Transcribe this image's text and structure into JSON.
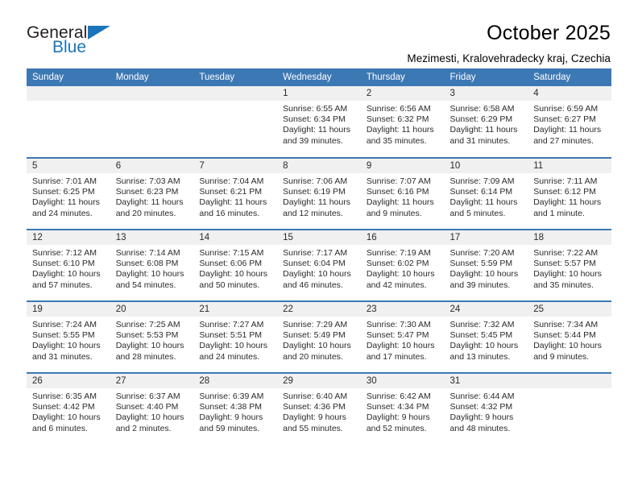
{
  "brand": {
    "name_top": "General",
    "name_bottom": "Blue",
    "triangle_color": "#1b75bb",
    "text_color": "#231f20"
  },
  "header": {
    "title": "October 2025",
    "subtitle": "Mezimesti, Kralovehradecky kraj, Czechia"
  },
  "theme": {
    "header_row_bg": "#3c78b4",
    "header_row_text": "#ffffff",
    "daynum_bg": "#f0f0f0",
    "cell_bg": "#ffffff",
    "grid_line": "#3c78b4"
  },
  "weekday_headers": [
    "Sunday",
    "Monday",
    "Tuesday",
    "Wednesday",
    "Thursday",
    "Friday",
    "Saturday"
  ],
  "weeks": [
    [
      {
        "day": "",
        "empty": true
      },
      {
        "day": "",
        "empty": true
      },
      {
        "day": "",
        "empty": true
      },
      {
        "day": "1",
        "sunrise": "Sunrise: 6:55 AM",
        "sunset": "Sunset: 6:34 PM",
        "daylight1": "Daylight: 11 hours",
        "daylight2": "and 39 minutes."
      },
      {
        "day": "2",
        "sunrise": "Sunrise: 6:56 AM",
        "sunset": "Sunset: 6:32 PM",
        "daylight1": "Daylight: 11 hours",
        "daylight2": "and 35 minutes."
      },
      {
        "day": "3",
        "sunrise": "Sunrise: 6:58 AM",
        "sunset": "Sunset: 6:29 PM",
        "daylight1": "Daylight: 11 hours",
        "daylight2": "and 31 minutes."
      },
      {
        "day": "4",
        "sunrise": "Sunrise: 6:59 AM",
        "sunset": "Sunset: 6:27 PM",
        "daylight1": "Daylight: 11 hours",
        "daylight2": "and 27 minutes."
      }
    ],
    [
      {
        "day": "5",
        "sunrise": "Sunrise: 7:01 AM",
        "sunset": "Sunset: 6:25 PM",
        "daylight1": "Daylight: 11 hours",
        "daylight2": "and 24 minutes."
      },
      {
        "day": "6",
        "sunrise": "Sunrise: 7:03 AM",
        "sunset": "Sunset: 6:23 PM",
        "daylight1": "Daylight: 11 hours",
        "daylight2": "and 20 minutes."
      },
      {
        "day": "7",
        "sunrise": "Sunrise: 7:04 AM",
        "sunset": "Sunset: 6:21 PM",
        "daylight1": "Daylight: 11 hours",
        "daylight2": "and 16 minutes."
      },
      {
        "day": "8",
        "sunrise": "Sunrise: 7:06 AM",
        "sunset": "Sunset: 6:19 PM",
        "daylight1": "Daylight: 11 hours",
        "daylight2": "and 12 minutes."
      },
      {
        "day": "9",
        "sunrise": "Sunrise: 7:07 AM",
        "sunset": "Sunset: 6:16 PM",
        "daylight1": "Daylight: 11 hours",
        "daylight2": "and 9 minutes."
      },
      {
        "day": "10",
        "sunrise": "Sunrise: 7:09 AM",
        "sunset": "Sunset: 6:14 PM",
        "daylight1": "Daylight: 11 hours",
        "daylight2": "and 5 minutes."
      },
      {
        "day": "11",
        "sunrise": "Sunrise: 7:11 AM",
        "sunset": "Sunset: 6:12 PM",
        "daylight1": "Daylight: 11 hours",
        "daylight2": "and 1 minute."
      }
    ],
    [
      {
        "day": "12",
        "sunrise": "Sunrise: 7:12 AM",
        "sunset": "Sunset: 6:10 PM",
        "daylight1": "Daylight: 10 hours",
        "daylight2": "and 57 minutes."
      },
      {
        "day": "13",
        "sunrise": "Sunrise: 7:14 AM",
        "sunset": "Sunset: 6:08 PM",
        "daylight1": "Daylight: 10 hours",
        "daylight2": "and 54 minutes."
      },
      {
        "day": "14",
        "sunrise": "Sunrise: 7:15 AM",
        "sunset": "Sunset: 6:06 PM",
        "daylight1": "Daylight: 10 hours",
        "daylight2": "and 50 minutes."
      },
      {
        "day": "15",
        "sunrise": "Sunrise: 7:17 AM",
        "sunset": "Sunset: 6:04 PM",
        "daylight1": "Daylight: 10 hours",
        "daylight2": "and 46 minutes."
      },
      {
        "day": "16",
        "sunrise": "Sunrise: 7:19 AM",
        "sunset": "Sunset: 6:02 PM",
        "daylight1": "Daylight: 10 hours",
        "daylight2": "and 42 minutes."
      },
      {
        "day": "17",
        "sunrise": "Sunrise: 7:20 AM",
        "sunset": "Sunset: 5:59 PM",
        "daylight1": "Daylight: 10 hours",
        "daylight2": "and 39 minutes."
      },
      {
        "day": "18",
        "sunrise": "Sunrise: 7:22 AM",
        "sunset": "Sunset: 5:57 PM",
        "daylight1": "Daylight: 10 hours",
        "daylight2": "and 35 minutes."
      }
    ],
    [
      {
        "day": "19",
        "sunrise": "Sunrise: 7:24 AM",
        "sunset": "Sunset: 5:55 PM",
        "daylight1": "Daylight: 10 hours",
        "daylight2": "and 31 minutes."
      },
      {
        "day": "20",
        "sunrise": "Sunrise: 7:25 AM",
        "sunset": "Sunset: 5:53 PM",
        "daylight1": "Daylight: 10 hours",
        "daylight2": "and 28 minutes."
      },
      {
        "day": "21",
        "sunrise": "Sunrise: 7:27 AM",
        "sunset": "Sunset: 5:51 PM",
        "daylight1": "Daylight: 10 hours",
        "daylight2": "and 24 minutes."
      },
      {
        "day": "22",
        "sunrise": "Sunrise: 7:29 AM",
        "sunset": "Sunset: 5:49 PM",
        "daylight1": "Daylight: 10 hours",
        "daylight2": "and 20 minutes."
      },
      {
        "day": "23",
        "sunrise": "Sunrise: 7:30 AM",
        "sunset": "Sunset: 5:47 PM",
        "daylight1": "Daylight: 10 hours",
        "daylight2": "and 17 minutes."
      },
      {
        "day": "24",
        "sunrise": "Sunrise: 7:32 AM",
        "sunset": "Sunset: 5:45 PM",
        "daylight1": "Daylight: 10 hours",
        "daylight2": "and 13 minutes."
      },
      {
        "day": "25",
        "sunrise": "Sunrise: 7:34 AM",
        "sunset": "Sunset: 5:44 PM",
        "daylight1": "Daylight: 10 hours",
        "daylight2": "and 9 minutes."
      }
    ],
    [
      {
        "day": "26",
        "sunrise": "Sunrise: 6:35 AM",
        "sunset": "Sunset: 4:42 PM",
        "daylight1": "Daylight: 10 hours",
        "daylight2": "and 6 minutes."
      },
      {
        "day": "27",
        "sunrise": "Sunrise: 6:37 AM",
        "sunset": "Sunset: 4:40 PM",
        "daylight1": "Daylight: 10 hours",
        "daylight2": "and 2 minutes."
      },
      {
        "day": "28",
        "sunrise": "Sunrise: 6:39 AM",
        "sunset": "Sunset: 4:38 PM",
        "daylight1": "Daylight: 9 hours",
        "daylight2": "and 59 minutes."
      },
      {
        "day": "29",
        "sunrise": "Sunrise: 6:40 AM",
        "sunset": "Sunset: 4:36 PM",
        "daylight1": "Daylight: 9 hours",
        "daylight2": "and 55 minutes."
      },
      {
        "day": "30",
        "sunrise": "Sunrise: 6:42 AM",
        "sunset": "Sunset: 4:34 PM",
        "daylight1": "Daylight: 9 hours",
        "daylight2": "and 52 minutes."
      },
      {
        "day": "31",
        "sunrise": "Sunrise: 6:44 AM",
        "sunset": "Sunset: 4:32 PM",
        "daylight1": "Daylight: 9 hours",
        "daylight2": "and 48 minutes."
      },
      {
        "day": "",
        "empty": true
      }
    ]
  ]
}
